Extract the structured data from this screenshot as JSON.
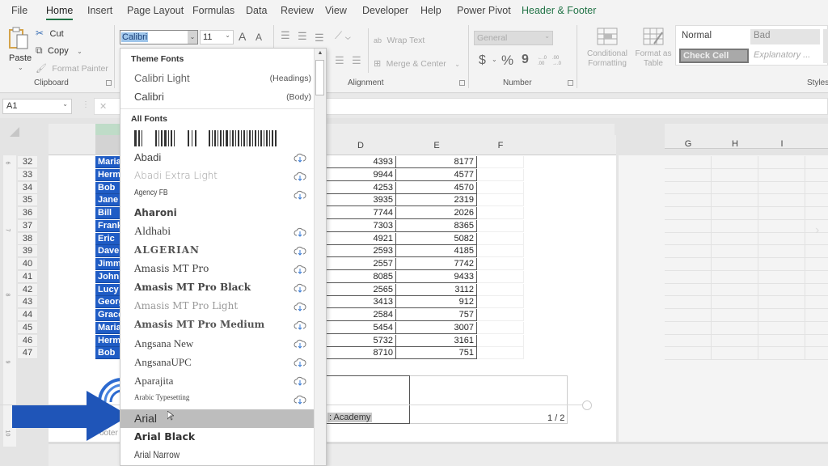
{
  "menu": {
    "tabs": [
      {
        "label": "File"
      },
      {
        "label": "Home",
        "active": true
      },
      {
        "label": "Insert"
      },
      {
        "label": "Page Layout"
      },
      {
        "label": "Formulas"
      },
      {
        "label": "Data"
      },
      {
        "label": "Review"
      },
      {
        "label": "View"
      },
      {
        "label": "Developer"
      },
      {
        "label": "Help"
      },
      {
        "label": "Power Pivot"
      },
      {
        "label": "Header & Footer",
        "contextual": true
      }
    ]
  },
  "ribbon": {
    "clipboard": {
      "paste": "Paste",
      "cut": "Cut",
      "copy": "Copy",
      "format_painter": "Format Painter",
      "label": "Clipboard"
    },
    "font": {
      "font_name": "Calibri",
      "font_size": "11",
      "grow": "A",
      "shrink": "A"
    },
    "alignment": {
      "wrap_text": "Wrap Text",
      "merge_center": "Merge & Center",
      "label": "Alignment"
    },
    "number": {
      "format": "General",
      "currency": "$",
      "percent": "%",
      "comma": "9",
      "inc_decimal": "←.0 .00",
      "dec_decimal": ".00 →.0",
      "label": "Number"
    },
    "styles": {
      "conditional_formatting": "Conditional Formatting",
      "format_as_table": "Format as Table",
      "cells": [
        {
          "label": "Normal"
        },
        {
          "label": "Bad"
        },
        {
          "label": "Check Cell"
        },
        {
          "label": "Explanatory ..."
        }
      ],
      "label": "Styles"
    }
  },
  "formula_bar": {
    "name_box": "A1",
    "cancel": "✕"
  },
  "font_dropdown": {
    "theme_fonts_header": "Theme Fonts",
    "theme_fonts": [
      {
        "name": "Calibri Light",
        "role": "(Headings)"
      },
      {
        "name": "Calibri",
        "role": "(Body)"
      }
    ],
    "all_fonts_header": "All Fonts",
    "fonts": [
      {
        "name": "Abadi",
        "cloud": true
      },
      {
        "name": "Abadi Extra Light",
        "cloud": true
      },
      {
        "name": "Agency FB",
        "cloud": true
      },
      {
        "name": "Aharoni",
        "cloud": false
      },
      {
        "name": "Aldhabi",
        "cloud": true
      },
      {
        "name": "ALGERIAN",
        "cloud": true
      },
      {
        "name": "Amasis MT Pro",
        "cloud": true
      },
      {
        "name": "Amasis MT Pro Black",
        "cloud": true
      },
      {
        "name": "Amasis MT Pro Light",
        "cloud": true
      },
      {
        "name": "Amasis MT Pro Medium",
        "cloud": true
      },
      {
        "name": "Angsana New",
        "cloud": true
      },
      {
        "name": "AngsanaUPC",
        "cloud": true
      },
      {
        "name": "Aparajita",
        "cloud": true
      },
      {
        "name": "Arabic Typesetting",
        "cloud": true
      },
      {
        "name": "Arial",
        "cloud": false,
        "hover": true
      },
      {
        "name": "Arial Black",
        "cloud": false
      },
      {
        "name": "Arial Narrow",
        "cloud": false
      }
    ]
  },
  "sheet": {
    "columns": [
      "D",
      "E",
      "F",
      "G",
      "H",
      "I"
    ],
    "rows": [
      {
        "row": "32",
        "name": "Maria",
        "d": "4393",
        "e": "8177"
      },
      {
        "row": "33",
        "name": "Herm",
        "d": "9944",
        "e": "4577"
      },
      {
        "row": "34",
        "name": "Bob",
        "d": "4253",
        "e": "4570"
      },
      {
        "row": "35",
        "name": "Jane",
        "d": "3935",
        "e": "2319"
      },
      {
        "row": "36",
        "name": "Bill",
        "d": "7744",
        "e": "2026"
      },
      {
        "row": "37",
        "name": "Frank",
        "d": "7303",
        "e": "8365"
      },
      {
        "row": "38",
        "name": "Eric",
        "d": "4921",
        "e": "5082"
      },
      {
        "row": "39",
        "name": "Dave",
        "d": "2593",
        "e": "4185"
      },
      {
        "row": "40",
        "name": "Jimm",
        "d": "2557",
        "e": "7742"
      },
      {
        "row": "41",
        "name": "John",
        "d": "8085",
        "e": "9433"
      },
      {
        "row": "42",
        "name": "Lucy",
        "d": "2565",
        "e": "3112"
      },
      {
        "row": "43",
        "name": "Georg",
        "d": "3413",
        "e": "912"
      },
      {
        "row": "44",
        "name": "Grace",
        "d": "2584",
        "e": "757"
      },
      {
        "row": "45",
        "name": "Maria",
        "d": "5454",
        "e": "3007"
      },
      {
        "row": "46",
        "name": "Herm",
        "d": "5732",
        "e": "3161"
      },
      {
        "row": "47",
        "name": "Bob",
        "d": "8710",
        "e": "751"
      }
    ],
    "footer": {
      "left_label": "ooter",
      "center_text": ": Academy",
      "right_text": "1 / 2"
    },
    "ruler_marks": [
      "6",
      "7",
      "8",
      "9",
      "10"
    ]
  },
  "colors": {
    "accent": "#217346",
    "selection": "#1f5cc5",
    "arrow": "#1f55b8"
  }
}
